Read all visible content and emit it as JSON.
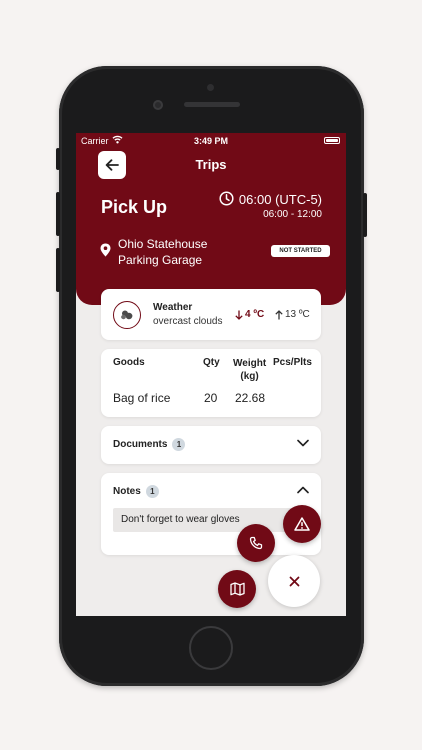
{
  "status_bar": {
    "carrier": "Carrier",
    "time": "3:49 PM"
  },
  "header": {
    "title": "Trips",
    "stop_type": "Pick Up",
    "eta": "06:00 (UTC-5)",
    "window": "06:00 - 12:00",
    "address_line1": "Ohio Statehouse",
    "address_line2": "Parking Garage",
    "status": "NOT STARTED"
  },
  "weather": {
    "title": "Weather",
    "description": "overcast clouds",
    "low": "4 ºC",
    "high": "13 ºC"
  },
  "goods": {
    "headers": [
      "Goods",
      "Qty",
      "Weight\n(kg)",
      "Pcs/Plts"
    ],
    "rows": [
      {
        "name": "Bag of rice",
        "qty": "20",
        "weight": "22.68",
        "pcs": ""
      }
    ]
  },
  "documents": {
    "label": "Documents",
    "count": "1",
    "expanded": false
  },
  "notes": {
    "label": "Notes",
    "count": "1",
    "expanded": true,
    "text": "Don't forget to wear gloves"
  },
  "colors": {
    "brand": "#710a16",
    "background": "#efedec",
    "card": "#ffffff",
    "badge": "#d0d8df"
  },
  "icons": {
    "back": "arrow-left-icon",
    "clock": "clock-icon",
    "pin": "map-pin-icon",
    "weather": "cloud-icon",
    "low": "arrow-down-icon",
    "high": "arrow-up-icon",
    "docs_toggle": "chevron-down-icon",
    "notes_toggle": "chevron-up-icon",
    "phone": "phone-icon",
    "alert": "warning-icon",
    "map": "map-icon",
    "close": "close-icon"
  }
}
